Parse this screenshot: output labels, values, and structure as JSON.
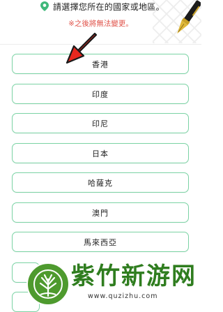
{
  "header": {
    "title": "請選擇您所在的國家或地區。",
    "warning": "※之後將無法變更。",
    "pin_icon": "location-pin-icon",
    "pen_icon": "fountain-pen-icon",
    "colors": {
      "accent_green": "#7bd3a4",
      "warning_red": "#e0534a",
      "arrow_red": "#e8281e"
    }
  },
  "options": [
    {
      "label": "香港"
    },
    {
      "label": "印度"
    },
    {
      "label": "印尼"
    },
    {
      "label": "日本"
    },
    {
      "label": "哈薩克"
    },
    {
      "label": "澳門"
    },
    {
      "label": "馬來西亞"
    },
    {
      "label": ""
    },
    {
      "label": ""
    }
  ],
  "watermark": {
    "name": "紫竹新游网",
    "url": "www.quzizhu.com"
  }
}
